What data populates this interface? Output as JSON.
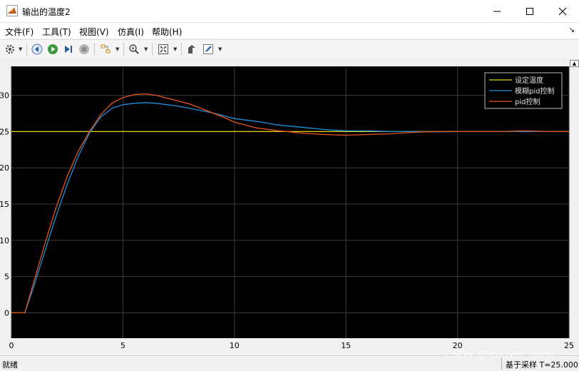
{
  "window": {
    "title": "输出的温度2",
    "app_icon": "matlab-icon"
  },
  "window_controls": {
    "minimize_icon": "minimize-icon",
    "maximize_icon": "maximize-icon",
    "close_icon": "close-icon"
  },
  "menu": [
    {
      "label": "文件(F)"
    },
    {
      "label": "工具(T)"
    },
    {
      "label": "视图(V)"
    },
    {
      "label": "仿真(I)"
    },
    {
      "label": "帮助(H)"
    }
  ],
  "menu_corner_icon": "arrow-icon",
  "toolbar": {
    "icons": [
      "gear-icon",
      "step-back-icon",
      "run-icon",
      "step-forward-icon",
      "stop-icon",
      "highlight-icon",
      "zoom-in-icon",
      "fit-to-view-icon",
      "style-icon",
      "edit-icon"
    ]
  },
  "chart_data": {
    "type": "line",
    "title": "",
    "xlabel": "",
    "ylabel": "",
    "xlim": [
      0,
      25
    ],
    "ylim": [
      -3.5,
      34
    ],
    "xticks": [
      0,
      5,
      10,
      15,
      20,
      25
    ],
    "yticks": [
      0,
      5,
      10,
      15,
      20,
      25,
      30
    ],
    "grid": true,
    "legend_position": "top-right",
    "colors": {
      "background": "#000000",
      "grid": "#3a3a3a",
      "tick_text": "#000000"
    },
    "series": [
      {
        "name": "设定温度",
        "color": "#e8d61c",
        "x": [
          0,
          25
        ],
        "y": [
          25,
          25
        ]
      },
      {
        "name": "模糊pid控制",
        "color": "#1f8fdc",
        "x": [
          0,
          0.6,
          1.0,
          1.5,
          2.0,
          2.5,
          3.0,
          3.5,
          4.0,
          4.5,
          5.0,
          5.5,
          6.0,
          6.5,
          7.0,
          7.5,
          8.0,
          8.5,
          9.0,
          9.5,
          10.0,
          11.0,
          12.0,
          13.0,
          14.0,
          15.0,
          16.0,
          17.0,
          18.0,
          19.0,
          20.0,
          21.0,
          22.0,
          23.0,
          24.0,
          25.0
        ],
        "y": [
          0,
          0,
          3.6,
          8.5,
          13.3,
          17.7,
          21.6,
          24.8,
          27.0,
          28.2,
          28.7,
          28.9,
          29.0,
          28.9,
          28.7,
          28.5,
          28.2,
          27.9,
          27.6,
          27.2,
          26.8,
          26.4,
          25.9,
          25.6,
          25.3,
          25.1,
          25.1,
          25.0,
          25.0,
          24.95,
          25.0,
          25.0,
          25.0,
          25.0,
          25.0,
          25.0
        ]
      },
      {
        "name": "pid控制",
        "color": "#e8561f",
        "x": [
          0,
          0.6,
          1.0,
          1.5,
          2.0,
          2.5,
          3.0,
          3.5,
          4.0,
          4.5,
          5.0,
          5.5,
          6.0,
          6.5,
          7.0,
          7.5,
          8.0,
          8.5,
          9.0,
          9.5,
          10.0,
          11.0,
          12.0,
          13.0,
          14.0,
          15.0,
          16.0,
          17.0,
          18.0,
          19.0,
          20.0,
          21.0,
          22.0,
          23.0,
          24.0,
          25.0
        ],
        "y": [
          0,
          0,
          4.2,
          9.5,
          14.5,
          18.8,
          22.3,
          25.0,
          27.3,
          28.9,
          29.7,
          30.1,
          30.2,
          30.0,
          29.6,
          29.2,
          28.8,
          28.2,
          27.6,
          27.0,
          26.3,
          25.5,
          25.1,
          24.8,
          24.6,
          24.5,
          24.6,
          24.7,
          24.9,
          25.0,
          25.0,
          25.0,
          25.0,
          25.1,
          25.0,
          25.0
        ]
      }
    ]
  },
  "status": {
    "left": "就绪",
    "right": "基于采样 T=25.000"
  },
  "watermark": "CSDN @studyer_domi"
}
